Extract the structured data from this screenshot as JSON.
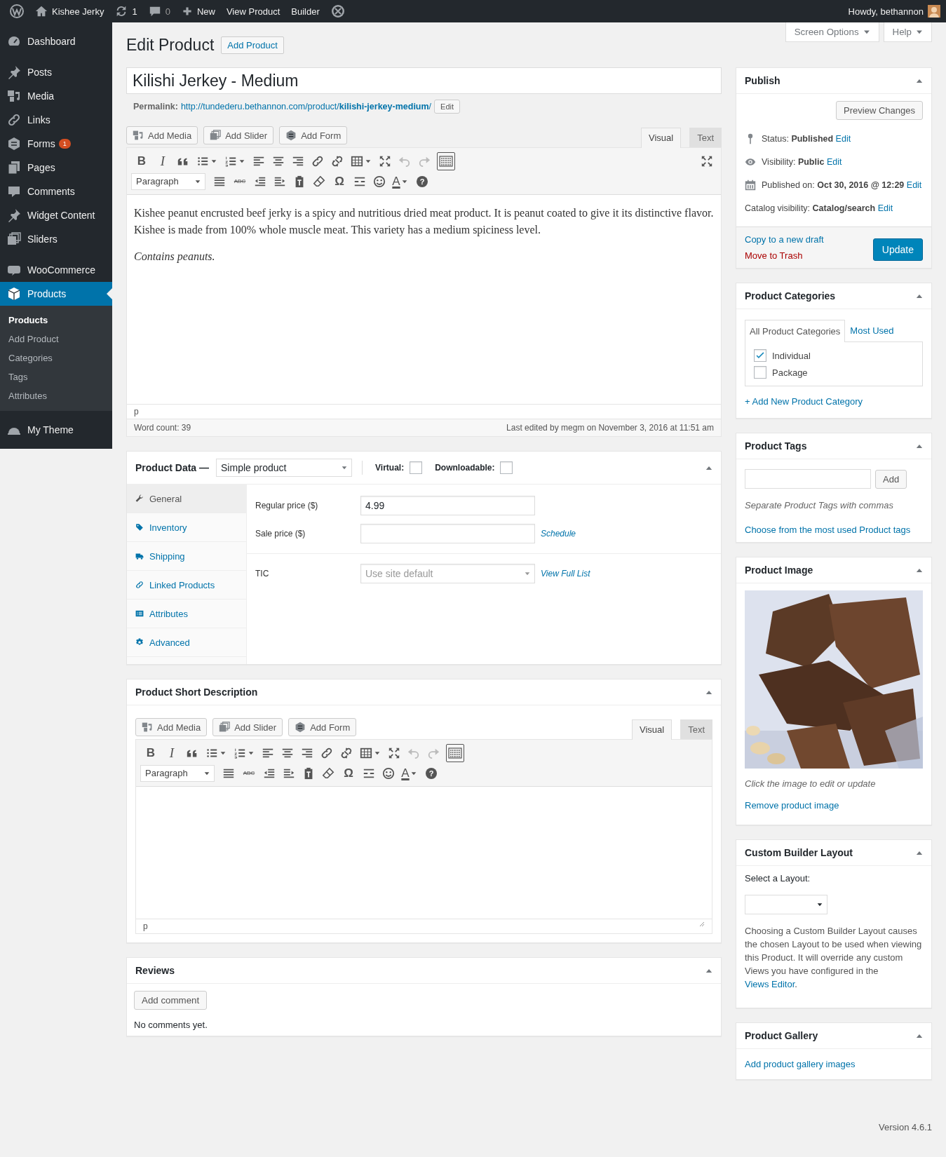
{
  "admin_bar": {
    "site": "Kishee Jerky",
    "updates": "1",
    "comments": "0",
    "new": "New",
    "links": [
      "View Product",
      "Builder"
    ],
    "greeting": "Howdy, bethannon"
  },
  "menu_groups": [
    [
      {
        "label": "Dashboard",
        "selected": false
      }
    ],
    [
      {
        "label": "Posts",
        "selected": false
      },
      {
        "label": "Media",
        "selected": false
      },
      {
        "label": "Links",
        "selected": false
      },
      {
        "label": "Forms",
        "selected": false,
        "badge": "1"
      },
      {
        "label": "Pages",
        "selected": false
      },
      {
        "label": "Comments",
        "selected": false
      },
      {
        "label": "Widget Content",
        "selected": false
      },
      {
        "label": "Sliders",
        "selected": false
      }
    ],
    [
      {
        "label": "WooCommerce",
        "selected": false
      },
      {
        "label": "Products",
        "selected": true,
        "children": [
          {
            "label": "Products",
            "selected": true
          },
          {
            "label": "Add Product",
            "selected": false
          },
          {
            "label": "Categories",
            "selected": false
          },
          {
            "label": "Tags",
            "selected": false
          },
          {
            "label": "Attributes",
            "selected": false
          }
        ]
      }
    ],
    [
      {
        "label": "My Theme",
        "selected": false
      }
    ]
  ],
  "page": {
    "title": "Edit Product",
    "add_button": "Add Product",
    "screen_options": "Screen Options",
    "help": "Help"
  },
  "post_title": "Kilishi Jerkey - Medium",
  "permalink": {
    "label": "Permalink:",
    "url": "http://tundederu.bethannon.com/product/**kilishi-jerkey-medium**/",
    "edit": "Edit"
  },
  "editor": {
    "media_buttons": [
      "Add Media",
      "Add Slider",
      "Add Form"
    ],
    "tabs": [
      {
        "label": "Visual",
        "selected": true
      },
      {
        "label": "Text",
        "selected": false
      }
    ],
    "format": "Paragraph",
    "glyphs": {
      "bold": "B",
      "italic": "I",
      "strike": "ABC",
      "special": "Ω",
      "font_tint": "A",
      "help": "?"
    },
    "toolbar_toggle_on": true,
    "history_disabled": true,
    "content": [
      {
        "text": "Kishee peanut encrusted beef jerky is a spicy and nutritious dried meat product. It is peanut coated to give it its distinctive flavor. Kishee is made from 100% whole muscle meat. This variety has a medium spiciness level.",
        "italic": false
      },
      {
        "text": "Contains peanuts.",
        "italic": true
      }
    ],
    "path": "p",
    "word_count": "Word count: 39",
    "last_edited": "Last edited by megm on November 3, 2016 at 11:51 am"
  },
  "product_data": {
    "title": "Product Data —",
    "type": "Simple product",
    "options": [
      {
        "label": "Virtual:",
        "checked": false
      },
      {
        "label": "Downloadable:",
        "checked": false
      }
    ],
    "tabs": [
      {
        "label": "General",
        "selected": true
      },
      {
        "label": "Inventory",
        "selected": false
      },
      {
        "label": "Shipping",
        "selected": false
      },
      {
        "label": "Linked Products",
        "selected": false
      },
      {
        "label": "Attributes",
        "selected": false
      },
      {
        "label": "Advanced",
        "selected": false
      }
    ],
    "field_groups": [
      [
        {
          "label": "Regular price ($)",
          "kind": "text",
          "value": "4.99"
        },
        {
          "label": "Sale price ($)",
          "kind": "text",
          "link": "Schedule"
        }
      ],
      [
        {
          "label": "TIC",
          "kind": "select",
          "placeholder": "Use site default",
          "link": "View Full List"
        }
      ]
    ]
  },
  "short_description": {
    "title": "Product Short Description",
    "editor": {
      "media_buttons": [
        "Add Media",
        "Add Slider",
        "Add Form"
      ],
      "tabs": [
        {
          "label": "Visual",
          "selected": true
        },
        {
          "label": "Text",
          "selected": false
        }
      ],
      "format": "Paragraph",
      "glyphs": {
        "bold": "B",
        "italic": "I",
        "strike": "ABC",
        "special": "Ω",
        "font_tint": "A",
        "help": "?"
      },
      "toolbar_toggle_on": true,
      "history_disabled": true,
      "path": "p"
    }
  },
  "reviews": {
    "title": "Reviews",
    "button": "Add comment",
    "empty": "No comments yet."
  },
  "publish": {
    "title": "Publish",
    "preview": "Preview Changes",
    "rows": [
      {
        "text": "Status: **Published**",
        "link": "Edit"
      },
      {
        "text": "Visibility: **Public**",
        "link": "Edit"
      },
      {
        "text": "Published on: **Oct 30, 2016 @ 12:29**",
        "link": "Edit"
      },
      {
        "text": "Catalog visibility: **Catalog/search**",
        "link": "Edit"
      }
    ],
    "copy": "Copy to a new draft",
    "trash": "Move to Trash",
    "update": "Update"
  },
  "categories": {
    "title": "Product Categories",
    "tabs": [
      {
        "label": "All Product Categories",
        "selected": true
      },
      {
        "label": "Most Used",
        "selected": false
      }
    ],
    "items": [
      {
        "label": "Individual",
        "checked": true
      },
      {
        "label": "Package",
        "checked": false
      }
    ],
    "add_link": "+ Add New Product Category"
  },
  "tags": {
    "title": "Product Tags",
    "add": "Add",
    "hint": "Separate Product Tags with commas",
    "link": "Choose from the most used Product tags"
  },
  "image": {
    "title": "Product Image",
    "hint": "Click the image to edit or update",
    "remove": "Remove product image"
  },
  "builder": {
    "title": "Custom Builder Layout",
    "label": "Select a Layout:",
    "description": "Choosing a Custom Builder Layout causes the chosen Layout to be used when viewing this Product. It will override any custom Views you have configured in the",
    "link": "Views Editor",
    "after": "."
  },
  "gallery": {
    "title": "Product Gallery",
    "link": "Add product gallery images"
  },
  "footer": {
    "version": "Version 4.6.1"
  }
}
